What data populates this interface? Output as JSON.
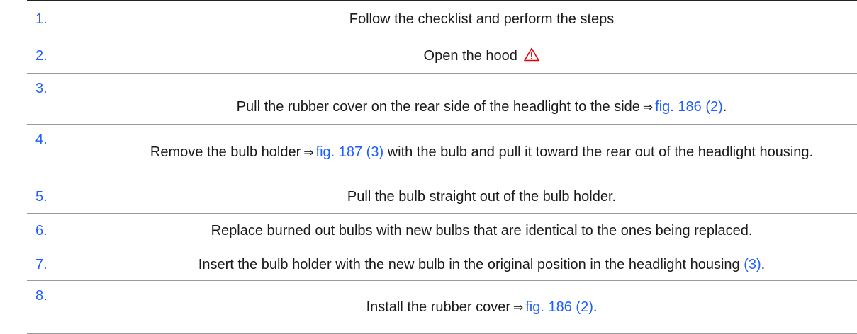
{
  "steps": [
    {
      "number": "1.",
      "text": "Follow the checklist and perform the steps"
    },
    {
      "number": "2.",
      "text": "Open the hood",
      "icon": "warning-triangle-icon",
      "icon_color": "#e00000"
    },
    {
      "number": "3.",
      "text_before": "Pull the rubber cover on the rear side of the headlight to the side",
      "arrow": "⇒",
      "link": "fig. 186 (2)",
      "text_after": "."
    },
    {
      "number": "4.",
      "text_before": "Remove the bulb holder",
      "arrow": "⇒",
      "link": "fig. 187 (3)",
      "text_after": "with the bulb and pull it toward the rear out of the headlight housing."
    },
    {
      "number": "5.",
      "text": "Pull the bulb straight out of the bulb holder."
    },
    {
      "number": "6.",
      "text": "Replace burned out bulbs with new bulbs that are identical to the ones being replaced."
    },
    {
      "number": "7.",
      "text_before": "Insert the bulb holder with the new bulb in the original position in the headlight housing",
      "link": "(3)",
      "text_after": "."
    },
    {
      "number": "8.",
      "text_before": "Install the rubber cover",
      "arrow": "⇒",
      "link": "fig. 186 (2)",
      "text_after": "."
    }
  ],
  "colors": {
    "step_number": "#1f5fff",
    "link": "#1f5fff",
    "warning": "#e00000",
    "text": "#1a1a1a"
  }
}
